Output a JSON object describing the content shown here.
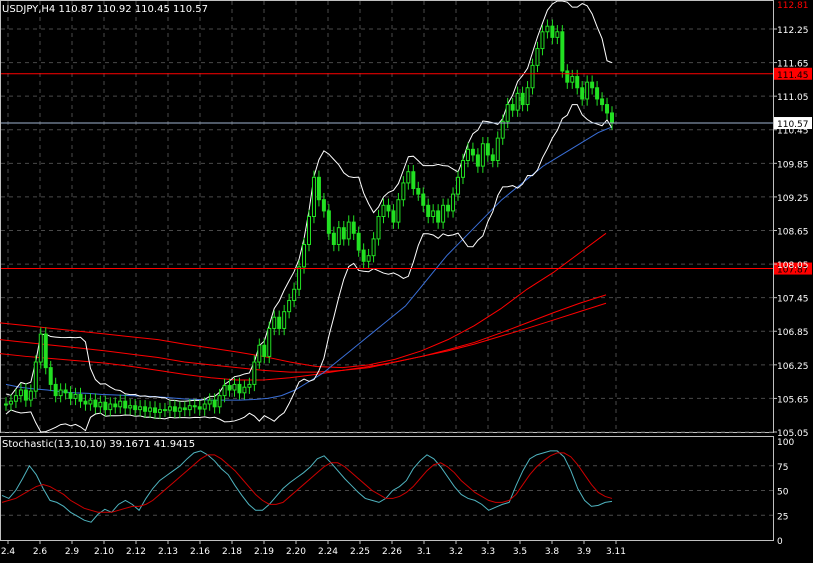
{
  "chart_data": [
    {
      "type": "candlestick",
      "symbol_label": "USDJPY,H4",
      "ohlc_label": "110.87 110.92 110.45 110.57",
      "y_ticks": [
        "112.25",
        "111.65",
        "111.05",
        "110.45",
        "109.85",
        "109.25",
        "108.65",
        "108.05",
        "107.45",
        "106.85",
        "106.25",
        "105.65",
        "105.05"
      ],
      "y_tick_values": [
        112.25,
        111.65,
        111.05,
        110.45,
        109.85,
        109.25,
        108.65,
        108.05,
        107.45,
        106.85,
        106.25,
        105.65,
        105.05
      ],
      "ylim": [
        105.05,
        112.75
      ],
      "top_label": "112.81",
      "price_label": "110.57",
      "price_value": 110.57,
      "hlines": [
        {
          "label": "111.45",
          "value": 111.45,
          "color": "#ff0000"
        },
        {
          "label": "107.87",
          "value": 107.97,
          "color": "#ff0000"
        }
      ],
      "x_ticks": [
        "2.4",
        "2.6",
        "2.9",
        "2.10",
        "2.12",
        "2.13",
        "2.16",
        "2.18",
        "2.19",
        "2.20",
        "2.24",
        "2.25",
        "2.26",
        "3.1",
        "3.2",
        "3.3",
        "3.5",
        "3.8",
        "3.9",
        "3.11"
      ],
      "closes": [
        105.55,
        105.6,
        105.7,
        105.8,
        105.62,
        105.78,
        106.3,
        106.8,
        106.2,
        105.9,
        105.7,
        105.8,
        105.75,
        105.65,
        105.72,
        105.6,
        105.55,
        105.62,
        105.5,
        105.58,
        105.45,
        105.55,
        105.5,
        105.6,
        105.48,
        105.52,
        105.45,
        105.5,
        105.42,
        105.48,
        105.4,
        105.45,
        105.44,
        105.5,
        105.42,
        105.48,
        105.45,
        105.52,
        105.5,
        105.46,
        105.55,
        105.62,
        105.5,
        105.7,
        105.88,
        105.8,
        105.9,
        105.75,
        105.85,
        105.9,
        106.3,
        106.6,
        106.4,
        106.9,
        107.1,
        106.9,
        107.2,
        107.4,
        107.6,
        108.0,
        108.4,
        108.9,
        109.6,
        109.2,
        109.0,
        108.6,
        108.4,
        108.7,
        108.5,
        108.8,
        108.6,
        108.3,
        108.1,
        108.2,
        108.5,
        108.9,
        109.1,
        109.0,
        108.8,
        109.2,
        109.5,
        109.7,
        109.4,
        109.3,
        109.1,
        108.9,
        109.0,
        108.8,
        109.1,
        109.0,
        109.3,
        109.6,
        109.9,
        110.1,
        110.0,
        109.8,
        110.2,
        110.0,
        109.9,
        110.3,
        110.6,
        110.9,
        110.8,
        111.1,
        110.9,
        111.2,
        111.6,
        111.9,
        112.2,
        112.3,
        112.1,
        112.2,
        111.5,
        111.3,
        111.4,
        111.2,
        111.0,
        111.3,
        111.2,
        111.0,
        110.9,
        110.75,
        110.57
      ],
      "ema_values": [
        105.9,
        105.85,
        105.82,
        105.8,
        105.77,
        105.75,
        105.74,
        105.72,
        105.71,
        105.7,
        105.69,
        105.68,
        105.66,
        105.64,
        105.63,
        105.62,
        105.62,
        105.62,
        105.63,
        105.65,
        105.7,
        105.8,
        105.95,
        106.1,
        106.3,
        106.5,
        106.7,
        106.9,
        107.1,
        107.3,
        107.6,
        107.9,
        108.2,
        108.45,
        108.7,
        108.95,
        109.2,
        109.4,
        109.6,
        109.8,
        109.95,
        110.1,
        110.25,
        110.4,
        110.5
      ],
      "ma_lines": [
        {
          "color": "#ff0000",
          "values": [
            107.0,
            106.95,
            106.9,
            106.85,
            106.8,
            106.75,
            106.7,
            106.62,
            106.55,
            106.48,
            106.4,
            106.3,
            106.22,
            106.2,
            106.25,
            106.35,
            106.5,
            106.7,
            106.95,
            107.25,
            107.6,
            107.9,
            108.25,
            108.6
          ]
        },
        {
          "color": "#ff0000",
          "values": [
            106.7,
            106.65,
            106.6,
            106.55,
            106.5,
            106.44,
            106.38,
            106.3,
            106.25,
            106.2,
            106.15,
            106.12,
            106.12,
            106.15,
            106.2,
            106.3,
            106.4,
            106.52,
            106.65,
            106.82,
            107.0,
            107.18,
            107.35,
            107.5
          ]
        },
        {
          "color": "#ff0000",
          "values": [
            106.45,
            106.4,
            106.36,
            106.32,
            106.28,
            106.22,
            106.15,
            106.08,
            106.02,
            105.98,
            105.98,
            106.02,
            106.08,
            106.15,
            106.22,
            106.3,
            106.4,
            106.5,
            106.62,
            106.76,
            106.9,
            107.05,
            107.2,
            107.35
          ]
        }
      ]
    },
    {
      "type": "line",
      "label": "Stochastic(13,10,10) 39.1671 41.9415",
      "y_ticks": [
        "100",
        "75",
        "50",
        "25",
        "0"
      ],
      "y_tick_values": [
        100,
        75,
        50,
        25,
        0
      ],
      "ylim": [
        0,
        100
      ],
      "series": [
        {
          "color": "#4fb3bf",
          "values": [
            45,
            42,
            50,
            62,
            75,
            66,
            52,
            40,
            38,
            34,
            28,
            24,
            20,
            18,
            26,
            31,
            28,
            36,
            40,
            36,
            30,
            42,
            52,
            60,
            65,
            70,
            75,
            82,
            88,
            90,
            86,
            80,
            72,
            66,
            55,
            45,
            36,
            30,
            30,
            36,
            44,
            52,
            58,
            63,
            68,
            74,
            82,
            85,
            78,
            70,
            62,
            55,
            48,
            42,
            40,
            38,
            42,
            50,
            54,
            60,
            72,
            80,
            86,
            82,
            74,
            64,
            54,
            46,
            42,
            40,
            36,
            30,
            33,
            36,
            38,
            55,
            70,
            82,
            86,
            88,
            90,
            90,
            84,
            70,
            52,
            40,
            34,
            35,
            38,
            39
          ]
        },
        {
          "color": "#cc0000",
          "values": [
            38,
            40,
            42,
            46,
            50,
            54,
            56,
            54,
            50,
            46,
            40,
            36,
            32,
            30,
            28,
            28,
            28,
            30,
            32,
            34,
            34,
            36,
            40,
            46,
            52,
            58,
            64,
            70,
            76,
            82,
            86,
            86,
            82,
            76,
            70,
            62,
            54,
            46,
            40,
            36,
            36,
            38,
            44,
            50,
            56,
            62,
            68,
            74,
            78,
            78,
            74,
            68,
            62,
            56,
            50,
            46,
            42,
            42,
            44,
            48,
            54,
            62,
            70,
            76,
            78,
            74,
            68,
            60,
            54,
            48,
            44,
            40,
            38,
            38,
            40,
            46,
            56,
            66,
            74,
            80,
            85,
            88,
            88,
            84,
            76,
            66,
            56,
            48,
            44,
            42
          ]
        }
      ]
    }
  ]
}
